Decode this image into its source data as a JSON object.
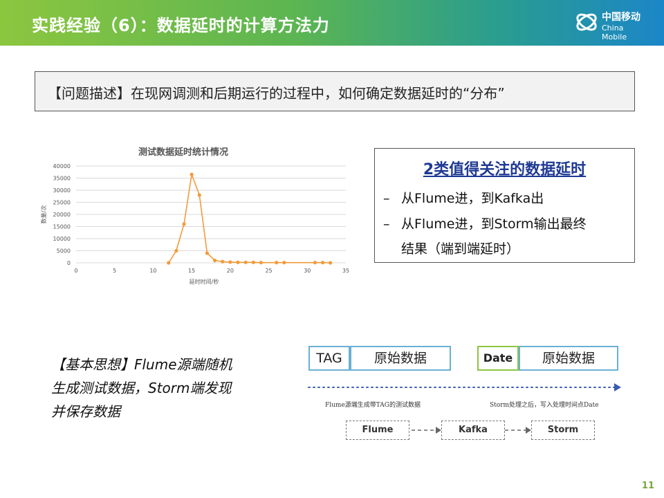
{
  "header": {
    "title": "实践经验（6）：数据延时的计算方法力",
    "logo_cn": "中国移动",
    "logo_en": "China Mobile"
  },
  "problem": {
    "text": "【问题描述】在现网调测和后期运行的过程中，如何确定数据延时的“分布”"
  },
  "chart_data": {
    "type": "line",
    "title": "测试数据延时统计情况",
    "xlabel": "延时时间/秒",
    "ylabel": "数量/次",
    "xlim": [
      0,
      35
    ],
    "ylim": [
      0,
      40000
    ],
    "x_ticks": [
      "0",
      "5",
      "10",
      "15",
      "20",
      "25",
      "30",
      "35"
    ],
    "y_ticks": [
      "0",
      "5000",
      "10000",
      "15000",
      "20000",
      "25000",
      "30000",
      "35000",
      "40000"
    ],
    "grid": true,
    "color": "#f29b3a",
    "series": [
      {
        "x": [
          12,
          13,
          14,
          15,
          16,
          17,
          18,
          19,
          20,
          21,
          22,
          23,
          24,
          26,
          27,
          31,
          32,
          33
        ],
        "y": [
          0,
          5000,
          16000,
          36500,
          28000,
          4000,
          1000,
          500,
          300,
          200,
          200,
          200,
          100,
          100,
          100,
          100,
          100,
          0
        ]
      }
    ]
  },
  "delay": {
    "title": "2类值得关注的数据延时",
    "item1_dash": "–",
    "item1": "从Flume进，到Kafka出",
    "item2_dash": "–",
    "item2_line1": "从Flume进，到Storm输出最终",
    "item2_line2": "结果（端到端延时）"
  },
  "idea": {
    "line1": "【基本思想】Flume源端随机",
    "line2": "生成测试数据，Storm端发现",
    "line3": "并保存数据"
  },
  "flow": {
    "tag": "TAG",
    "raw1": "原始数据",
    "date": "Date",
    "raw2": "原始数据",
    "caption_left": "Flume源端生成带TAG的测试数据",
    "caption_right": "Storm处理之后，写入处理时间点Date",
    "node1": "Flume",
    "node2": "Kafka",
    "node3": "Storm"
  },
  "page": {
    "number": "11"
  }
}
